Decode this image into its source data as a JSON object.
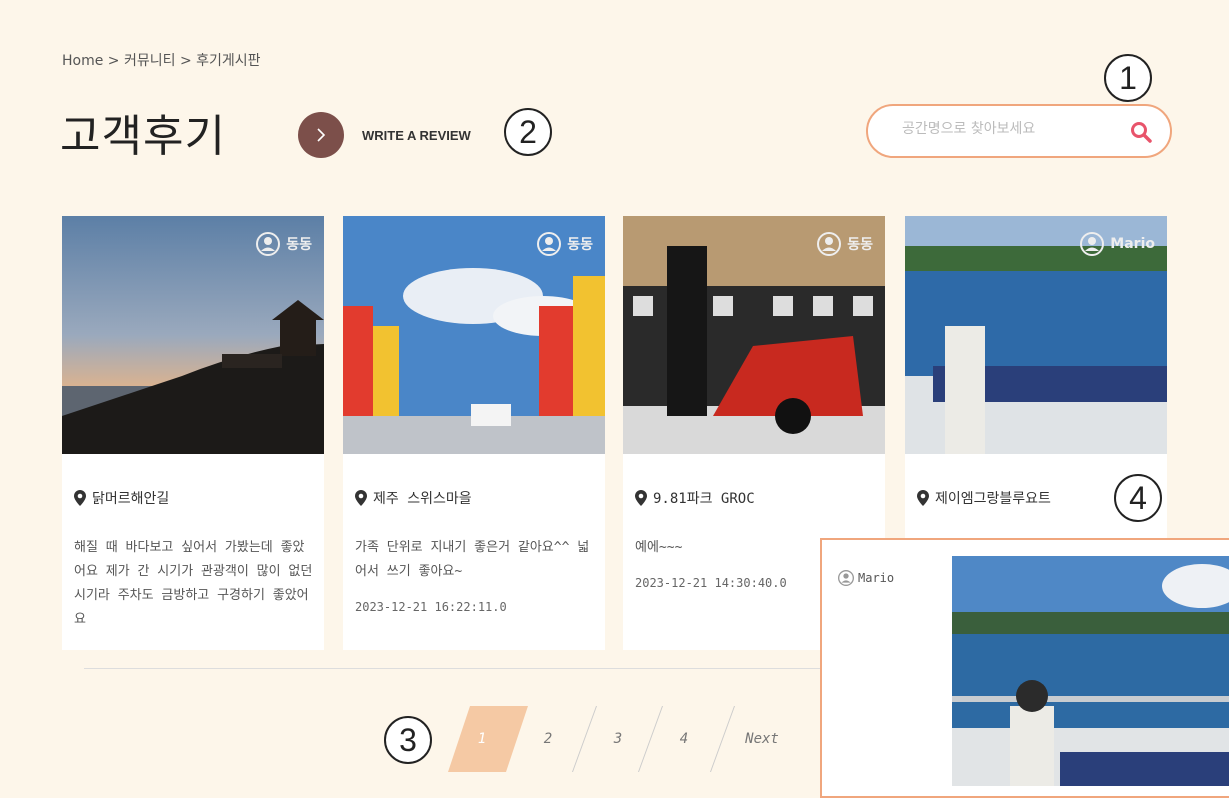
{
  "breadcrumb": "Home > 커뮤니티 > 후기게시판",
  "title": "고객후기",
  "write_button": {
    "label": "WRITE A REVIEW",
    "icon": "chevron-right-icon"
  },
  "search": {
    "placeholder": "공간명으로 찾아보세요",
    "icon": "search-icon"
  },
  "annotations": {
    "a1": "1",
    "a2": "2",
    "a3": "3",
    "a4": "4"
  },
  "cards": [
    {
      "author": "동동",
      "place": "닭머르해안길",
      "desc": "해질 때 바다보고 싶어서 가봤는데 좋았어요 제가 간 시기가 관광객이 많이 없던 시기라 주차도 금방하고 구경하기 좋았어요",
      "date": ""
    },
    {
      "author": "동동",
      "place": "제주 스위스마을",
      "desc": "가족 단위로 지내기 좋은거 같아요^^ 넓어서 쓰기 좋아요~",
      "date": "2023-12-21 16:22:11.0"
    },
    {
      "author": "동동",
      "place": "9.81파크 GROC",
      "desc": "예에~~~",
      "date": "2023-12-21 14:30:40.0"
    },
    {
      "author": "Mario",
      "place": "제이엠그랑블루요트",
      "desc": "",
      "date": ""
    }
  ],
  "pagination": {
    "pages": [
      "1",
      "2",
      "3",
      "4"
    ],
    "next": "Next",
    "active": "1"
  },
  "preview": {
    "author": "Mario"
  },
  "colors": {
    "accent": "#f0a67d",
    "write_button": "#7c4f4a",
    "search_icon": "#e8546b",
    "page_active": "#f5c9a4",
    "background": "#fdf6ea"
  }
}
